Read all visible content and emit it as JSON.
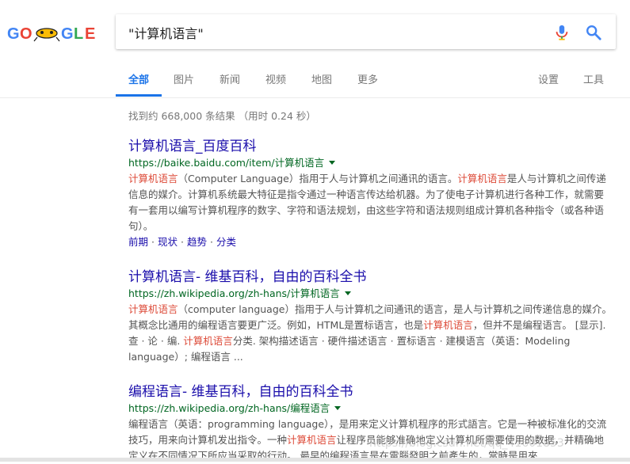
{
  "search": {
    "query": "\"计算机语言\"",
    "logo_text": "GOOGLE"
  },
  "tabs": [
    {
      "label": "全部",
      "active": true
    },
    {
      "label": "图片"
    },
    {
      "label": "新闻"
    },
    {
      "label": "视频"
    },
    {
      "label": "地图"
    },
    {
      "label": "更多"
    }
  ],
  "tools": {
    "settings": "设置",
    "tools": "工具"
  },
  "stats": "找到约 668,000 条结果 （用时 0.24 秒）",
  "results": [
    {
      "title": "计算机语言_百度百科",
      "url": "https://baike.baidu.com/item/计算机语言",
      "snippet": [
        {
          "t": "计算机语言",
          "hl": true
        },
        {
          "t": "（Computer Language）指用于人与计算机之间通讯的语言。"
        },
        {
          "t": "计算机语言",
          "hl": true
        },
        {
          "t": "是人与计算机之间传递信息的媒介。计算机系统最大特征是指令通过一种语言传达给机器。为了使电子计算机进行各种工作，就需要有一套用以编写计算机程序的数字、字符和语法规划，由这些字符和语法规则组成计算机各种指令（或各种语句）。"
        }
      ],
      "sitelinks": [
        "前期",
        "现状",
        "趋势",
        "分类"
      ]
    },
    {
      "title": "计算机语言- 维基百科，自由的百科全书",
      "url": "https://zh.wikipedia.org/zh-hans/计算机语言",
      "snippet": [
        {
          "t": "计算机语言",
          "hl": true
        },
        {
          "t": "（computer language）指用于人与计算机之间通讯的语言，是人与计算机之间传递信息的媒介。其概念比通用的编程语言要更广泛。例如，HTML是置标语言，也是"
        },
        {
          "t": "计算机语言",
          "hl": true
        },
        {
          "t": "，但并不是编程语言。 [显示]. 查 · 论 · 编. "
        },
        {
          "t": "计算机语言",
          "hl": true
        },
        {
          "t": "分类. 架构描述语言 · 硬件描述语言 · 置标语言 · 建模语言（英语：Modeling language）; 编程语言 ..."
        }
      ]
    },
    {
      "title": "编程语言- 维基百科，自由的百科全书",
      "url": "https://zh.wikipedia.org/zh-hans/编程语言",
      "snippet": [
        {
          "t": "编程语言（英语：programming language），是用来定义计算机程序的形式語言。它是一种被标准化的交流技巧，用来向计算机发出指令。一种"
        },
        {
          "t": "计算机语言",
          "hl": true
        },
        {
          "t": "让程序员能够准确地定义计算机所需要使用的数据，并精确地定义在不同情况下所应当采取的行动。 最早的编程语言是在電腦發明之前產生的，當時是用來"
        }
      ]
    }
  ],
  "watermark": "https://blog.csdn.net/qq_41601853",
  "colors": {
    "link": "#1a0dab",
    "url": "#006621",
    "highlight": "#dd4b39",
    "accent": "#1a73e8"
  }
}
